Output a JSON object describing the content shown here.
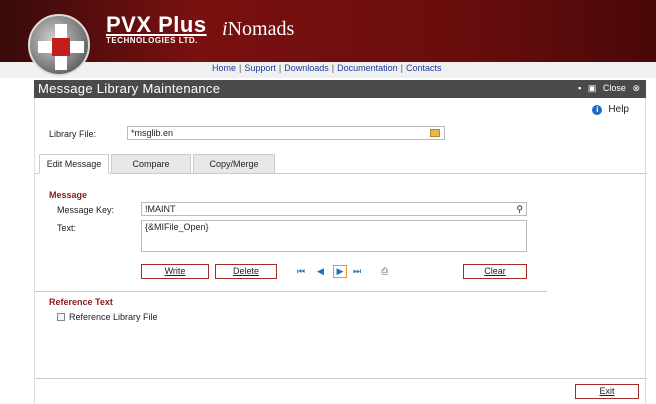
{
  "brand": {
    "name": "PVX Plus",
    "sub": "TECHNOLOGIES LTD.",
    "product_prefix": "i",
    "product": "Nomads"
  },
  "nav": {
    "links": [
      "Home",
      "Support",
      "Downloads",
      "Documentation",
      "Contacts"
    ],
    "separator": "|"
  },
  "titlebar": {
    "title": "Message Library Maintenance",
    "close_label": "Close"
  },
  "help": {
    "label": "Help"
  },
  "library": {
    "label": "Library File:",
    "value": "*msglib.en"
  },
  "tabs": [
    {
      "label": "Edit Message",
      "active": true
    },
    {
      "label": "Compare",
      "active": false
    },
    {
      "label": "Copy/Merge",
      "active": false
    }
  ],
  "message": {
    "section_title": "Message",
    "key_label": "Message Key:",
    "key_value": "!MAINT",
    "text_label": "Text:",
    "text_value": "{&MIFile_Open}"
  },
  "buttons": {
    "write": "Write",
    "delete": "Delete",
    "clear": "Clear",
    "exit": "Exit"
  },
  "reference": {
    "section_title": "Reference Text",
    "checkbox_label": "Reference Library File"
  },
  "colors": {
    "banner": "#7a1010",
    "titlebar": "#4a4a4a",
    "accent": "#8a1a1a",
    "link": "#1a3a9c"
  }
}
